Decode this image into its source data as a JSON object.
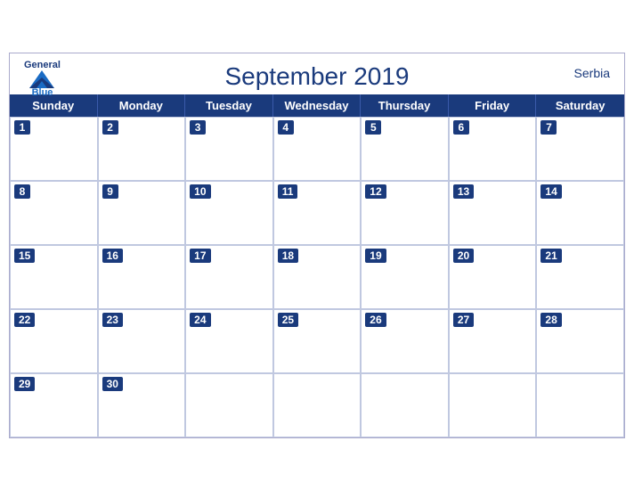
{
  "calendar": {
    "title": "September 2019",
    "country": "Serbia",
    "days_of_week": [
      "Sunday",
      "Monday",
      "Tuesday",
      "Wednesday",
      "Thursday",
      "Friday",
      "Saturday"
    ],
    "weeks": [
      [
        {
          "day": 1,
          "empty": false
        },
        {
          "day": 2,
          "empty": false
        },
        {
          "day": 3,
          "empty": false
        },
        {
          "day": 4,
          "empty": false
        },
        {
          "day": 5,
          "empty": false
        },
        {
          "day": 6,
          "empty": false
        },
        {
          "day": 7,
          "empty": false
        }
      ],
      [
        {
          "day": 8,
          "empty": false
        },
        {
          "day": 9,
          "empty": false
        },
        {
          "day": 10,
          "empty": false
        },
        {
          "day": 11,
          "empty": false
        },
        {
          "day": 12,
          "empty": false
        },
        {
          "day": 13,
          "empty": false
        },
        {
          "day": 14,
          "empty": false
        }
      ],
      [
        {
          "day": 15,
          "empty": false
        },
        {
          "day": 16,
          "empty": false
        },
        {
          "day": 17,
          "empty": false
        },
        {
          "day": 18,
          "empty": false
        },
        {
          "day": 19,
          "empty": false
        },
        {
          "day": 20,
          "empty": false
        },
        {
          "day": 21,
          "empty": false
        }
      ],
      [
        {
          "day": 22,
          "empty": false
        },
        {
          "day": 23,
          "empty": false
        },
        {
          "day": 24,
          "empty": false
        },
        {
          "day": 25,
          "empty": false
        },
        {
          "day": 26,
          "empty": false
        },
        {
          "day": 27,
          "empty": false
        },
        {
          "day": 28,
          "empty": false
        }
      ],
      [
        {
          "day": 29,
          "empty": false
        },
        {
          "day": 30,
          "empty": false
        },
        {
          "day": null,
          "empty": true
        },
        {
          "day": null,
          "empty": true
        },
        {
          "day": null,
          "empty": true
        },
        {
          "day": null,
          "empty": true
        },
        {
          "day": null,
          "empty": true
        }
      ]
    ],
    "logo": {
      "general": "General",
      "blue": "Blue"
    }
  }
}
